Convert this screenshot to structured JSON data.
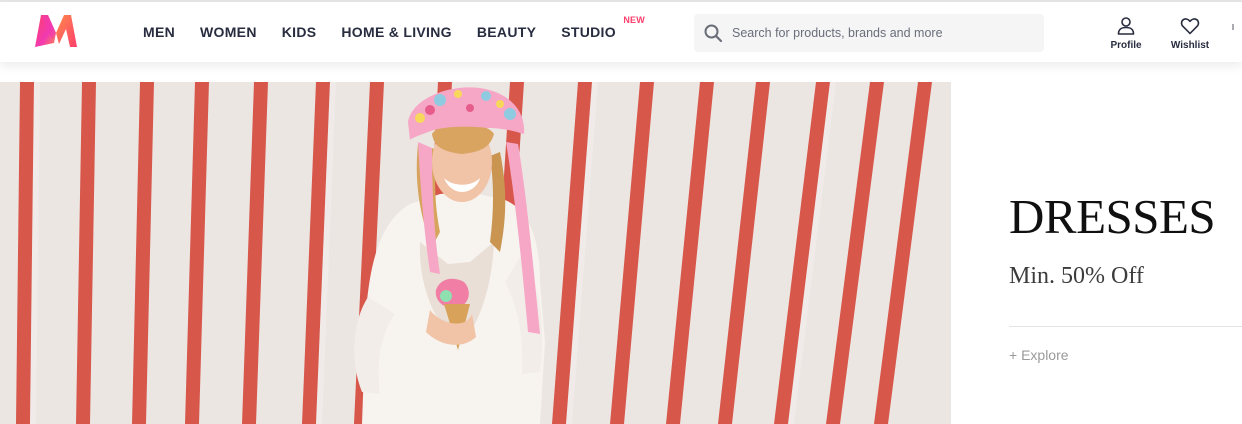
{
  "header": {
    "logo_name": "myntra-logo",
    "nav": [
      {
        "label": "MEN"
      },
      {
        "label": "WOMEN"
      },
      {
        "label": "KIDS"
      },
      {
        "label": "HOME & LIVING"
      },
      {
        "label": "BEAUTY"
      },
      {
        "label": "STUDIO",
        "badge": "NEW"
      }
    ],
    "search": {
      "placeholder": "Search for products, brands and more",
      "value": ""
    },
    "actions": {
      "profile_label": "Profile",
      "wishlist_label": "Wishlist"
    }
  },
  "banner": {
    "title": "DRESSES",
    "subtitle": "Min. 50% Off",
    "cta": "+ Explore"
  },
  "colors": {
    "accent": "#ff3f6c",
    "text": "#282c3f",
    "stripe": "#d8574b",
    "wall": "#ece6e3"
  }
}
